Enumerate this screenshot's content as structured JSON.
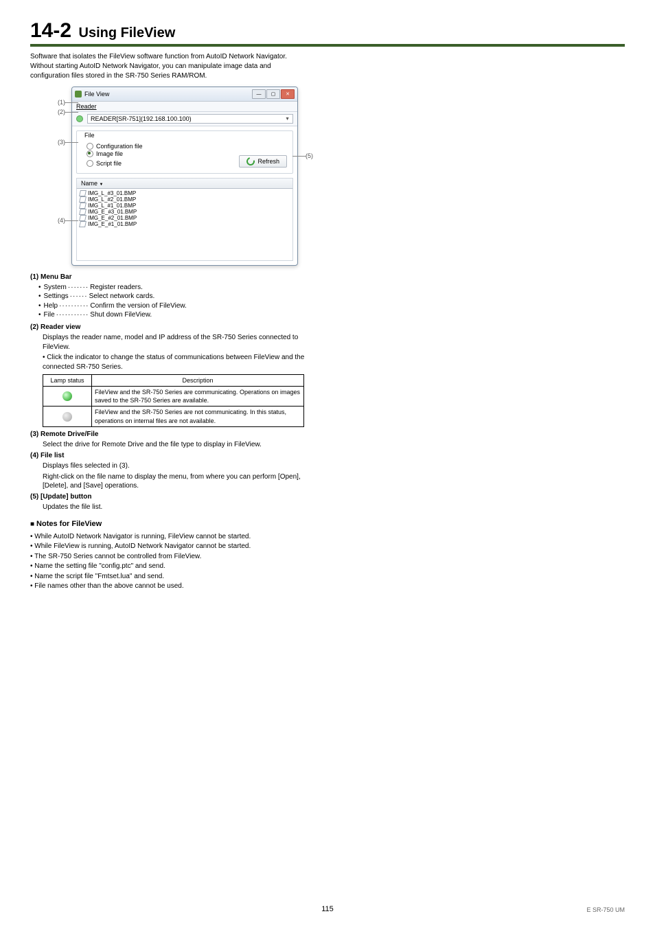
{
  "section": {
    "number": "14-2",
    "title": "Using FileView"
  },
  "intro": "Software that isolates the FileView software function from AutoID Network Navigator. Without starting AutoID Network Navigator, you can manipulate image data and configuration files stored in the SR-750 Series RAM/ROM.",
  "callouts": {
    "c1": "(1)",
    "c2": "(2)",
    "c3": "(3)",
    "c4": "(4)",
    "c5": "(5)"
  },
  "window": {
    "title": "File View",
    "menu": "Reader",
    "readerBox": "READER[SR-751](192.168.100.100)",
    "panelTitle": "File",
    "radios": {
      "r1": "Configuration file",
      "r2": "Image file",
      "r3": "Script file"
    },
    "refresh": "Refresh",
    "listHead": "Name",
    "files": [
      "IMG_L_#3_01.BMP",
      "IMG_L_#2_01.BMP",
      "IMG_L_#1_01.BMP",
      "IMG_E_#3_01.BMP",
      "IMG_E_#2_01.BMP",
      "IMG_E_#1_01.BMP"
    ]
  },
  "menuBar": {
    "heading": "(1) Menu Bar",
    "items": [
      {
        "label": "System",
        "dots": "·······",
        "desc": "Register readers."
      },
      {
        "label": "Settings",
        "dots": "······",
        "desc": "Select network cards."
      },
      {
        "label": "Help",
        "dots": "··········",
        "desc": "Confirm the version of FileView."
      },
      {
        "label": "File",
        "dots": "···········",
        "desc": "Shut down FileView."
      }
    ]
  },
  "readerView": {
    "heading": "(2) Reader view",
    "p1": "Displays the reader name, model and IP address of the SR-750 Series connected to FileView.",
    "li1": "Click the indicator to change the status of communications between FileView and the connected SR-750 Series."
  },
  "table": {
    "h1": "Lamp status",
    "h2": "Description",
    "row1": "FileView and the SR-750 Series are communicating. Operations on images saved to the SR-750 Series are available.",
    "row2": "FileView and the SR-750 Series are not communicating. In this status, operations on internal files are not available."
  },
  "item3": {
    "heading": "(3) Remote Drive/File",
    "p": "Select the drive for Remote Drive and the file type to display in FileView."
  },
  "item4": {
    "heading": "(4) File list",
    "p1": "Displays files selected in (3).",
    "p2": "Right-click on the file name to display the menu, from where you can perform [Open], [Delete], and [Save] operations."
  },
  "item5": {
    "heading": "(5) [Update] button",
    "p": "Updates the file list."
  },
  "notes": {
    "heading": "Notes for FileView",
    "items": [
      "While AutoID Network Navigator is running, FileView cannot be started.",
      "While FileView is running, AutoID Network Navigator cannot be started.",
      "The SR-750 Series cannot be controlled from FileView.",
      "Name the setting file \"config.ptc\" and send.",
      "Name the script file \"Fmtset.lua\" and send.",
      "File names other than the above cannot be used."
    ]
  },
  "footer": {
    "page": "115",
    "right": "E SR-750 UM"
  }
}
